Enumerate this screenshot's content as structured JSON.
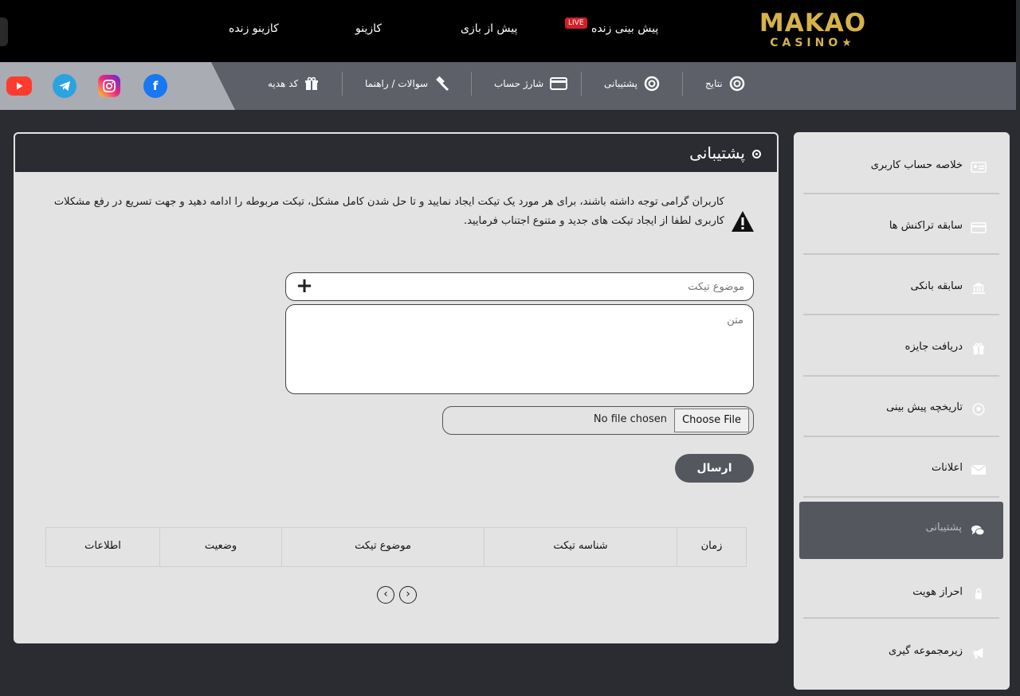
{
  "header": {
    "logo_main": "MAKAO",
    "logo_sub": "CASINO",
    "live_badge": "LIVE",
    "nav": [
      {
        "label": "پیش بینی زنده"
      },
      {
        "label": "پیش از بازی"
      },
      {
        "label": "کازینو"
      },
      {
        "label": "کازینو زنده"
      }
    ]
  },
  "subnav": [
    {
      "label": "نتایج",
      "icon": "soccer-ball-icon"
    },
    {
      "label": "پشتیبانی",
      "icon": "lifebuoy-icon"
    },
    {
      "label": "شارژ حساب",
      "icon": "credit-card-icon"
    },
    {
      "label": "سوالات / راهنما",
      "icon": "gavel-icon"
    },
    {
      "label": "کد هدیه",
      "icon": "gift-icon"
    }
  ],
  "social": [
    {
      "name": "facebook",
      "color": "#1877f2",
      "glyph": "f"
    },
    {
      "name": "instagram",
      "color": "#d62976",
      "glyph": "◎"
    },
    {
      "name": "telegram",
      "color": "#2aa3e0",
      "glyph": "➤"
    },
    {
      "name": "youtube",
      "color": "#ff0000",
      "glyph": "▶"
    }
  ],
  "card": {
    "title": "پشتیبانی",
    "notice": "کاربران گرامی توجه داشته باشند، برای هر مورد یک تیکت ایجاد نمایید و تا حل شدن کامل مشکل، تیکت مربوطه را ادامه دهید و جهت تسریع در رفع مشکلات کاربری لطفا از ایجاد تیکت های جدید و متنوع اجتناب فرمایید.",
    "subject_placeholder": "موضوع تیکت",
    "text_placeholder": "متن",
    "file_button": "Choose File",
    "file_status": "No file chosen",
    "submit": "ارسال",
    "table_headers": [
      "زمان",
      "شناسه تیکت",
      "موضوع تیکت",
      "وضعیت",
      "اطلاعات"
    ]
  },
  "sidebar": {
    "items": [
      {
        "label": "خلاصه حساب کاربری",
        "icon": "id-card-icon"
      },
      {
        "label": "سابقه تراکنش ها",
        "icon": "credit-card-icon"
      },
      {
        "label": "سابقه بانکی",
        "icon": "bank-icon"
      },
      {
        "label": "دریافت جایزه",
        "icon": "gift-icon"
      },
      {
        "label": "تاریخچه پیش بینی",
        "icon": "soccer-ball-icon"
      },
      {
        "label": "اعلانات",
        "icon": "envelope-icon"
      },
      {
        "label": "پشتیبانی",
        "icon": "chat-icon",
        "active": true
      },
      {
        "label": "احراز هویت",
        "icon": "lock-icon"
      },
      {
        "label": "زیرمجموعه گیری",
        "icon": "megaphone-icon"
      }
    ]
  },
  "colors": {
    "brand_gold": "#d6b24a",
    "header_bg": "#000000",
    "subbar_bg": "#5d6069",
    "page_bg": "#2b2c31",
    "card_bg": "#e4e3e4",
    "active_item": "#54575e"
  }
}
